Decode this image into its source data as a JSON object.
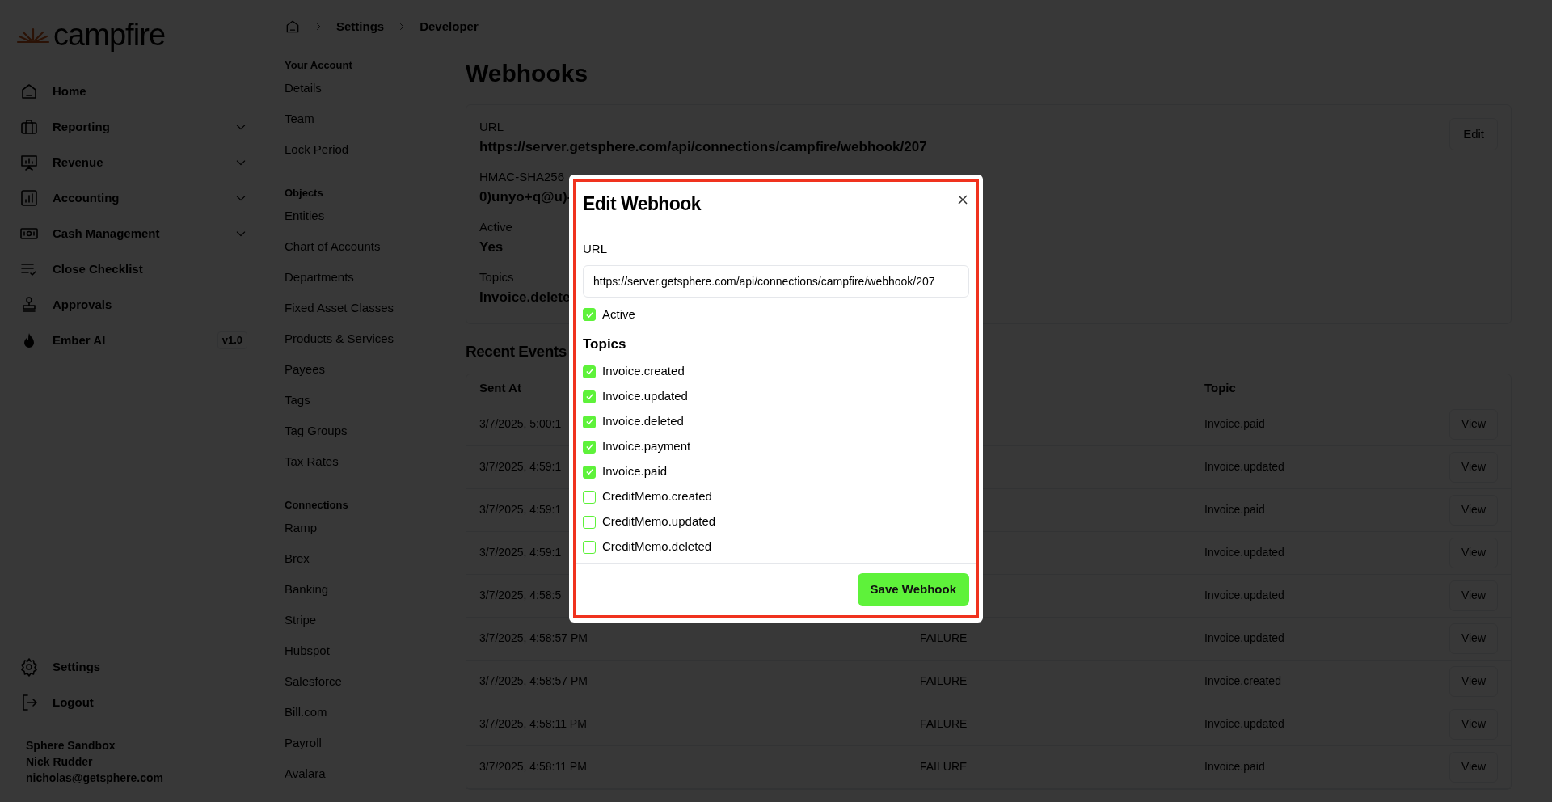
{
  "sidebar": {
    "logo": "campfire",
    "items": [
      {
        "label": "Home",
        "kind": "link"
      },
      {
        "label": "Reporting",
        "kind": "group"
      },
      {
        "label": "Revenue",
        "kind": "group"
      },
      {
        "label": "Accounting",
        "kind": "group"
      },
      {
        "label": "Cash Management",
        "kind": "group"
      },
      {
        "label": "Close Checklist",
        "kind": "link"
      },
      {
        "label": "Approvals",
        "kind": "link"
      },
      {
        "label": "Ember AI",
        "kind": "link",
        "badge": "v1.0"
      }
    ],
    "footer_items": [
      {
        "label": "Settings"
      },
      {
        "label": "Logout"
      }
    ],
    "account": {
      "org": "Sphere Sandbox",
      "name": "Nick Rudder",
      "email": "nicholas@getsphere.com"
    }
  },
  "breadcrumb": [
    "Settings",
    "Developer"
  ],
  "settings_nav": [
    {
      "heading": "Your Account",
      "items": [
        "Details",
        "Team",
        "Lock Period"
      ]
    },
    {
      "heading": "Objects",
      "items": [
        "Entities",
        "Chart of Accounts",
        "Departments",
        "Fixed Asset Classes",
        "Products & Services",
        "Payees",
        "Tags",
        "Tag Groups",
        "Tax Rates"
      ]
    },
    {
      "heading": "Connections",
      "items": [
        "Ramp",
        "Brex",
        "Banking",
        "Stripe",
        "Hubspot",
        "Salesforce",
        "Bill.com",
        "Payroll",
        "Avalara"
      ]
    }
  ],
  "webhook": {
    "title": "Webhooks",
    "edit_button": "Edit",
    "fields": [
      {
        "label": "URL",
        "value": "https://server.getsphere.com/api/connections/campfire/webhook/207"
      },
      {
        "label": "HMAC-SHA256",
        "value": "0)unyo+q@u)-"
      },
      {
        "label": "Active",
        "value": "Yes"
      },
      {
        "label": "Topics",
        "value": "Invoice.delete"
      }
    ]
  },
  "recent_events": {
    "title": "Recent Events",
    "columns": {
      "sent_at": "Sent At",
      "topic": "Topic"
    },
    "rows": [
      {
        "sent_at": "3/7/2025, 5:00:1",
        "topic": "Invoice.paid",
        "action": "View"
      },
      {
        "sent_at": "3/7/2025, 4:59:1",
        "topic": "Invoice.updated",
        "action": "View"
      },
      {
        "sent_at": "3/7/2025, 4:59:1",
        "topic": "Invoice.paid",
        "action": "View"
      },
      {
        "sent_at": "3/7/2025, 4:59:1",
        "topic": "Invoice.updated",
        "action": "View"
      },
      {
        "sent_at": "3/7/2025, 4:58:5",
        "topic": "Invoice.updated",
        "action": "View"
      },
      {
        "sent_at": "3/7/2025, 4:58:57 PM",
        "status": "FAILURE",
        "topic": "Invoice.updated",
        "action": "View"
      },
      {
        "sent_at": "3/7/2025, 4:58:57 PM",
        "status": "FAILURE",
        "topic": "Invoice.created",
        "action": "View"
      },
      {
        "sent_at": "3/7/2025, 4:58:11 PM",
        "status": "FAILURE",
        "topic": "Invoice.updated",
        "action": "View"
      },
      {
        "sent_at": "3/7/2025, 4:58:11 PM",
        "status": "FAILURE",
        "topic": "Invoice.paid",
        "action": "View"
      }
    ]
  },
  "modal": {
    "title": "Edit Webhook",
    "url_label": "URL",
    "url_value": "https://server.getsphere.com/api/connections/campfire/webhook/207",
    "active": {
      "label": "Active",
      "checked": true
    },
    "topics_heading": "Topics",
    "topics": [
      {
        "label": "Invoice.created",
        "checked": true
      },
      {
        "label": "Invoice.updated",
        "checked": true
      },
      {
        "label": "Invoice.deleted",
        "checked": true
      },
      {
        "label": "Invoice.payment",
        "checked": true
      },
      {
        "label": "Invoice.paid",
        "checked": true
      },
      {
        "label": "CreditMemo.created",
        "checked": false
      },
      {
        "label": "CreditMemo.updated",
        "checked": false
      },
      {
        "label": "CreditMemo.deleted",
        "checked": false
      }
    ],
    "save_button": "Save Webhook"
  }
}
